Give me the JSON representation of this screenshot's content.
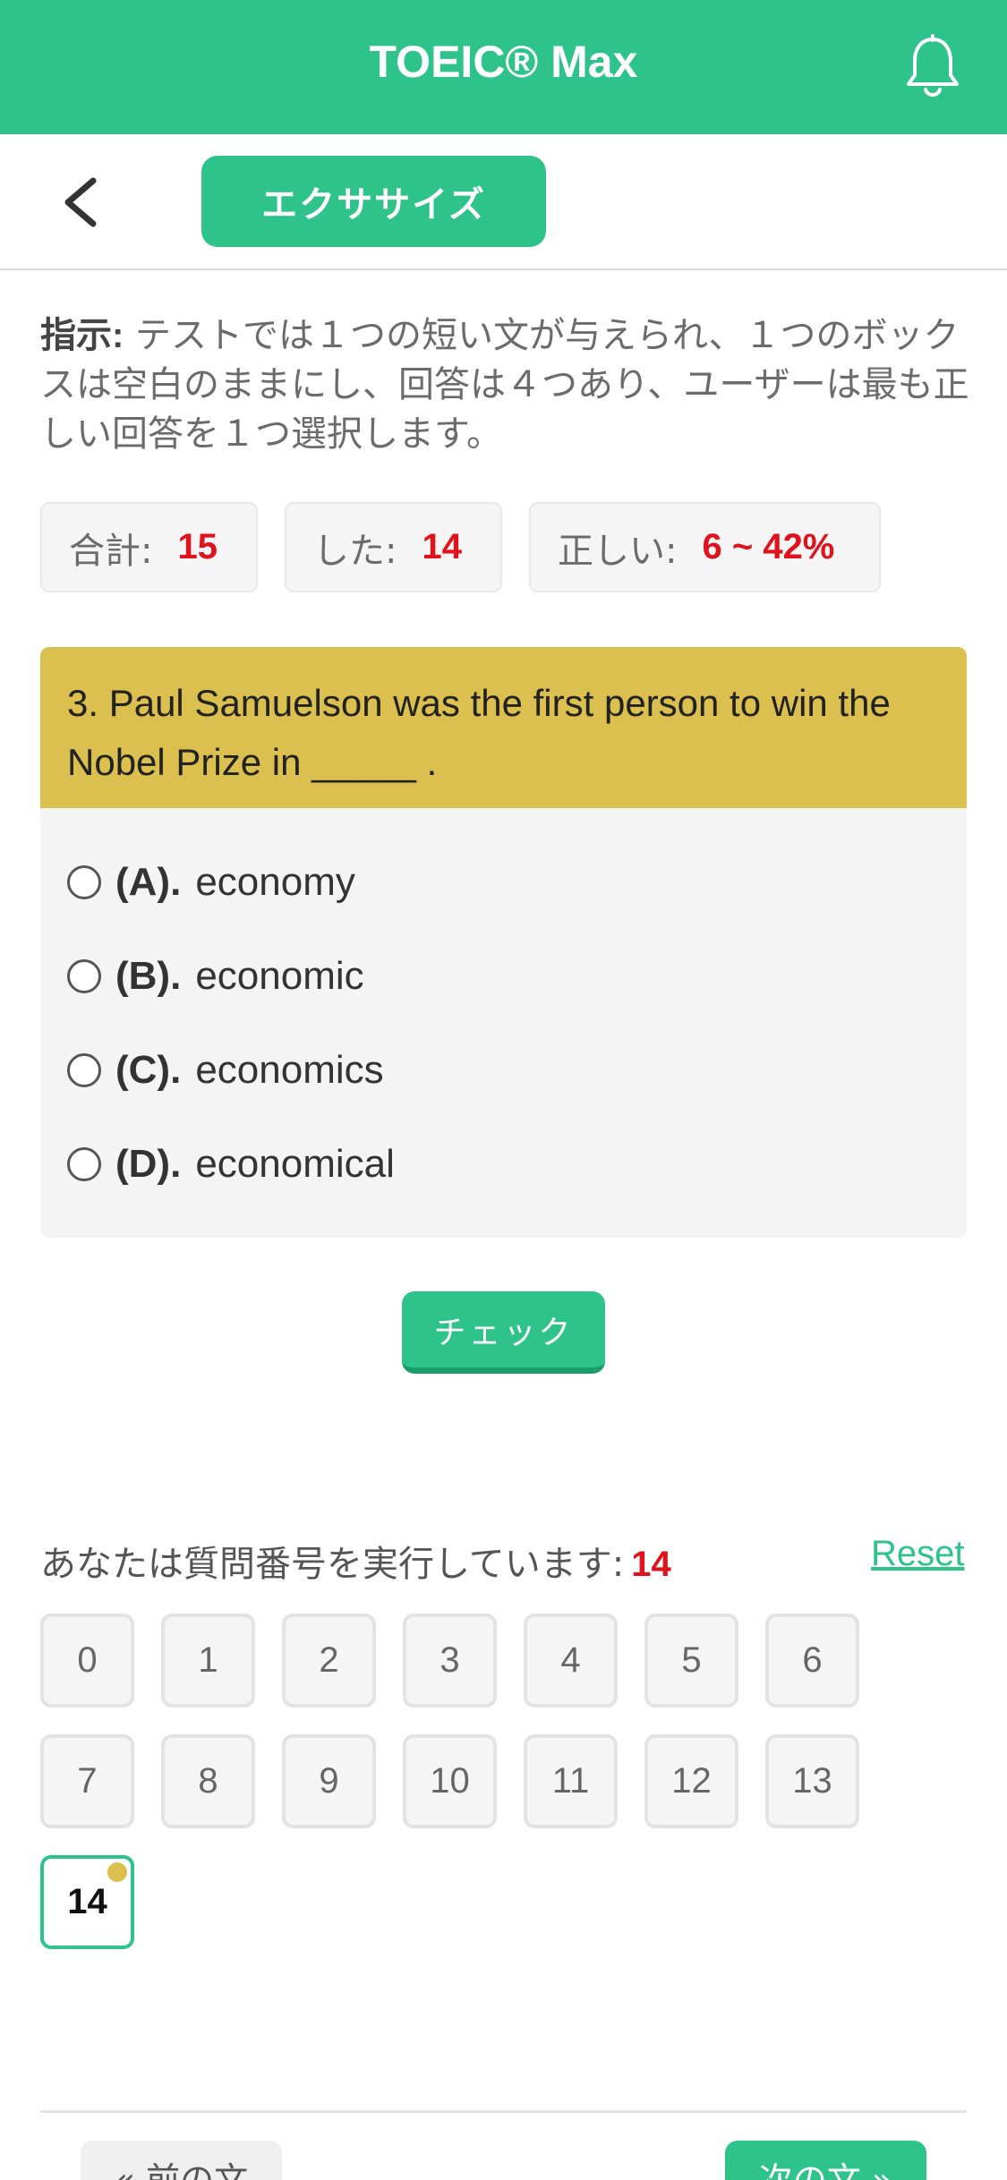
{
  "header": {
    "title": "TOEIC® Max",
    "bell_icon": "bell-icon"
  },
  "subnav": {
    "back_icon": "chevron-left-icon",
    "tab_label": "エクササイズ"
  },
  "instructions": {
    "label": "指示:",
    "text": " テストでは１つの短い文が与えられ、１つのボックスは空白のままにし、回答は４つあり、ユーザーは最も正しい回答を１つ選択します。"
  },
  "stats": [
    {
      "label": "合計:",
      "value": "15"
    },
    {
      "label": "した:",
      "value": "14"
    },
    {
      "label": "正しい:",
      "value": "6 ~ 42%"
    }
  ],
  "question": {
    "text": "3. Paul Samuelson was the first person to win the Nobel Prize in _____ .",
    "options": [
      {
        "letter": "(A).",
        "text": "economy"
      },
      {
        "letter": "(B).",
        "text": "economic"
      },
      {
        "letter": "(C).",
        "text": "economics"
      },
      {
        "letter": "(D).",
        "text": "economical"
      }
    ]
  },
  "check_label": "チェック",
  "progress": {
    "label": "あなたは質問番号を実行しています:",
    "current": "14",
    "reset_label": "Reset",
    "numbers": [
      "0",
      "1",
      "2",
      "3",
      "4",
      "5",
      "6",
      "7",
      "8",
      "9",
      "10",
      "11",
      "12",
      "13",
      "14"
    ]
  },
  "footer": {
    "prev_label": "« 前の文",
    "next_label": "次の文 »"
  },
  "colors": {
    "brand": "#2ec38a",
    "question_header": "#dbbf4f",
    "highlight_red": "#e0121b"
  }
}
